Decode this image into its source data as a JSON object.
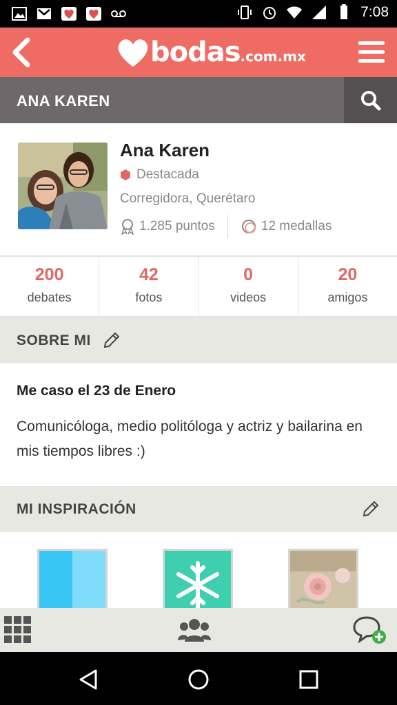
{
  "status_bar": {
    "time": "7:08",
    "left_icons": [
      "image-icon",
      "gmail-icon",
      "heart-app-icon",
      "heart-app-icon",
      "voicemail-icon"
    ],
    "right_icons": [
      "vibrate-icon",
      "alarm-icon",
      "wifi-icon",
      "signal-icon",
      "battery-icon"
    ]
  },
  "app_bar": {
    "logo_main": "bodas",
    "logo_domain": ".com.mx",
    "brand_color": "#ee6c64"
  },
  "name_bar": {
    "title": "ANA KAREN"
  },
  "profile": {
    "name": "Ana Karen",
    "badge": "Destacada",
    "location": "Corregidora, Querétaro",
    "points": "1.285 puntos",
    "medals": "12 medallas"
  },
  "counters": [
    {
      "value": "200",
      "label": "debates"
    },
    {
      "value": "42",
      "label": "fotos"
    },
    {
      "value": "0",
      "label": "videos"
    },
    {
      "value": "20",
      "label": "amigos"
    }
  ],
  "about": {
    "section_title": "SOBRE MI",
    "heading": "Me caso el 23 de Enero",
    "text": "Comunicóloga, medio politóloga y actriz y bailarina en mis tiempos libres :)"
  },
  "inspiration": {
    "section_title": "MI INSPIRACIÓN",
    "thumbs": [
      "blue-color-swatch",
      "snowflake-image",
      "rose-photo"
    ]
  },
  "tab_bar": {
    "items": [
      "grid-icon",
      "community-icon",
      "add-chat-icon"
    ]
  },
  "nav_bar": {
    "items": [
      "back-triangle-icon",
      "home-circle-icon",
      "recents-square-icon"
    ]
  },
  "colors": {
    "accent": "#e06a63",
    "namebar": "#6e686b",
    "section_bg": "#e8e8e3"
  }
}
